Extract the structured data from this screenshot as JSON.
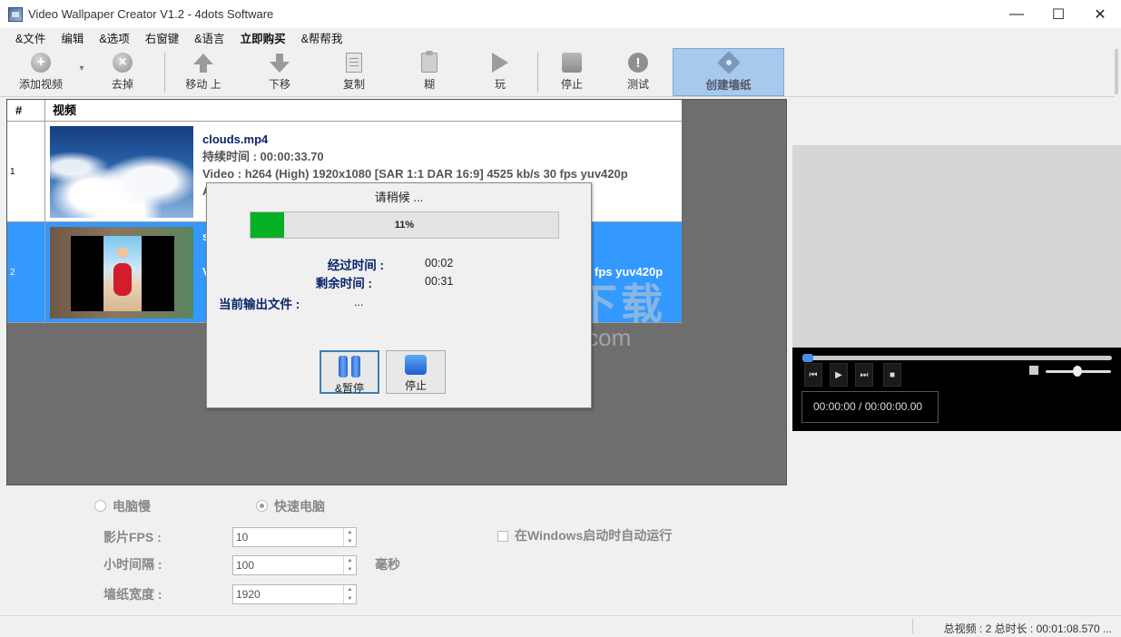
{
  "window": {
    "title": "Video Wallpaper Creator V1.2 - 4dots Software",
    "min": "—",
    "max": "☐",
    "close": "✕"
  },
  "menu": [
    "&文件",
    "编辑",
    "&选项",
    "右窗键",
    "&语言",
    "立即购买",
    "&帮帮我"
  ],
  "toolbar": {
    "add": "添加视频",
    "remove": "去掉",
    "move_up": "移动 上",
    "move_down": "下移",
    "copy": "复制",
    "paste": "糊",
    "play": "玩",
    "stop": "停止",
    "test": "测试",
    "create": "创建墙纸",
    "add_glyph": "+",
    "remove_glyph": "×",
    "dropdown": "▾",
    "test_glyph": "!"
  },
  "grid": {
    "col_num": "#",
    "col_video": "视频",
    "rows": [
      {
        "num": "1",
        "filename": "clouds.mp4",
        "duration": "持续时间 : 00:00:33.70",
        "video": "Video : h264 (High) 1920x1080 [SAR 1:1 DAR 16:9] 4525 kb/s 30 fps yuv420p",
        "audio": "A"
      },
      {
        "num": "2",
        "frag_left": "V",
        "frag_top": "s",
        "frag_right": "fps yuv420p"
      }
    ]
  },
  "dialog": {
    "title": "请稍候 ...",
    "progress_text": "11%",
    "progress_percent": 11,
    "elapsed_label": "经过时间 :",
    "elapsed": "00:02",
    "remaining_label": "剩余时间 :",
    "remaining": "00:31",
    "output_label": "当前输出文件 :",
    "output": "...",
    "pause": "&暂停",
    "stop": "停止"
  },
  "watermark": {
    "brand": "安下载",
    "site": "anxz.com",
    "glyph": "安"
  },
  "player": {
    "time": "00:00:00 / 00:00:00.00",
    "prev": "⏮",
    "play": "▶",
    "next": "⏭",
    "stop": "■"
  },
  "options": {
    "slow_pc": "电脑慢",
    "fast_pc": "快速电脑",
    "fps_label": "影片FPS :",
    "fps": "10",
    "interval_label": "小时间隔 :",
    "interval": "100",
    "ms": "毫秒",
    "width_label": "墙纸宽度 :",
    "width": "1920",
    "autorun": "在Windows启动时自动运行",
    "spin_up": "▲",
    "spin_down": "▼"
  },
  "status": {
    "text": "总视频 : 2   总时长 : 00:01:08.570  ..."
  },
  "colors": {
    "selected_row": "#3399ff",
    "progress": "#06b025",
    "create_button": "#a7c9ec"
  }
}
